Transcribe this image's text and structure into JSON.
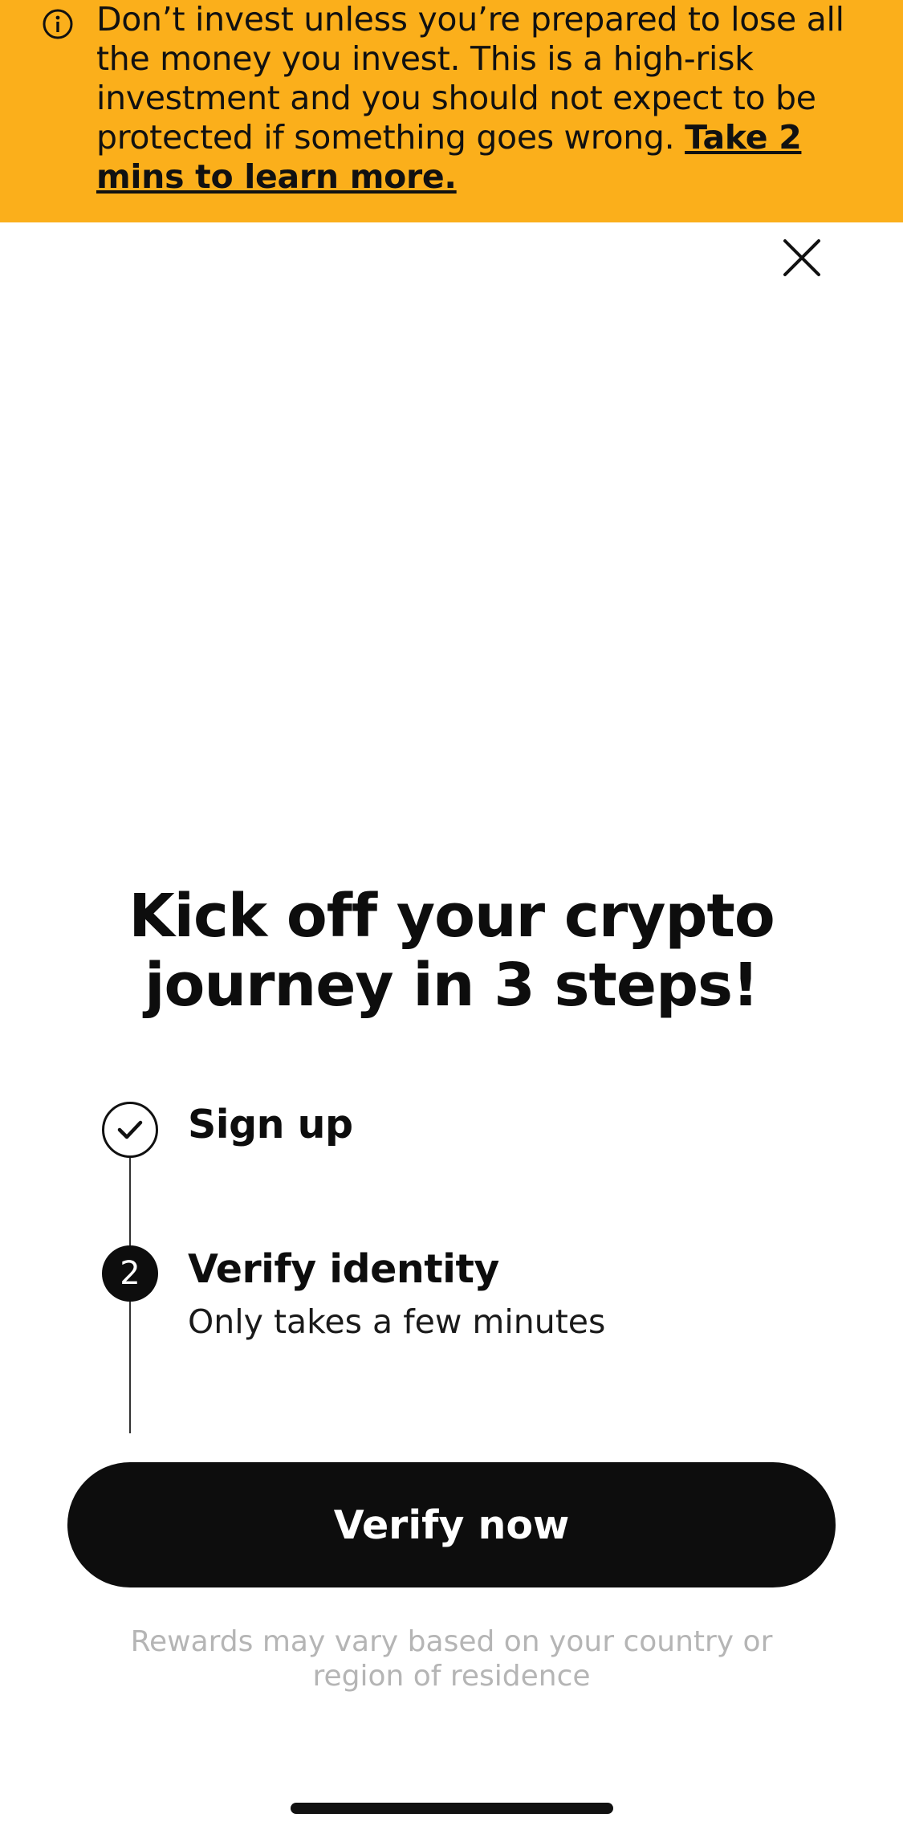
{
  "banner": {
    "text": "Don’t invest unless you’re prepared to lose all the money you invest. This is a high-risk investment and you should not expect to be protected if something goes wrong.",
    "link_text": "Take 2 mins to learn more.",
    "background_color": "#fbaf1b",
    "icon": "info-icon"
  },
  "close_icon": "close-icon",
  "headline": {
    "line1": "Kick off your crypto",
    "line2": "journey in 3 steps!"
  },
  "steps": [
    {
      "status": "completed",
      "marker": "check-icon",
      "title": "Sign up"
    },
    {
      "status": "current",
      "number": "2",
      "title": "Verify identity",
      "subtitle": "Only takes a few minutes"
    }
  ],
  "cta": {
    "label": "Verify now"
  },
  "disclaimer": "Rewards may vary based on your country or region of residence"
}
